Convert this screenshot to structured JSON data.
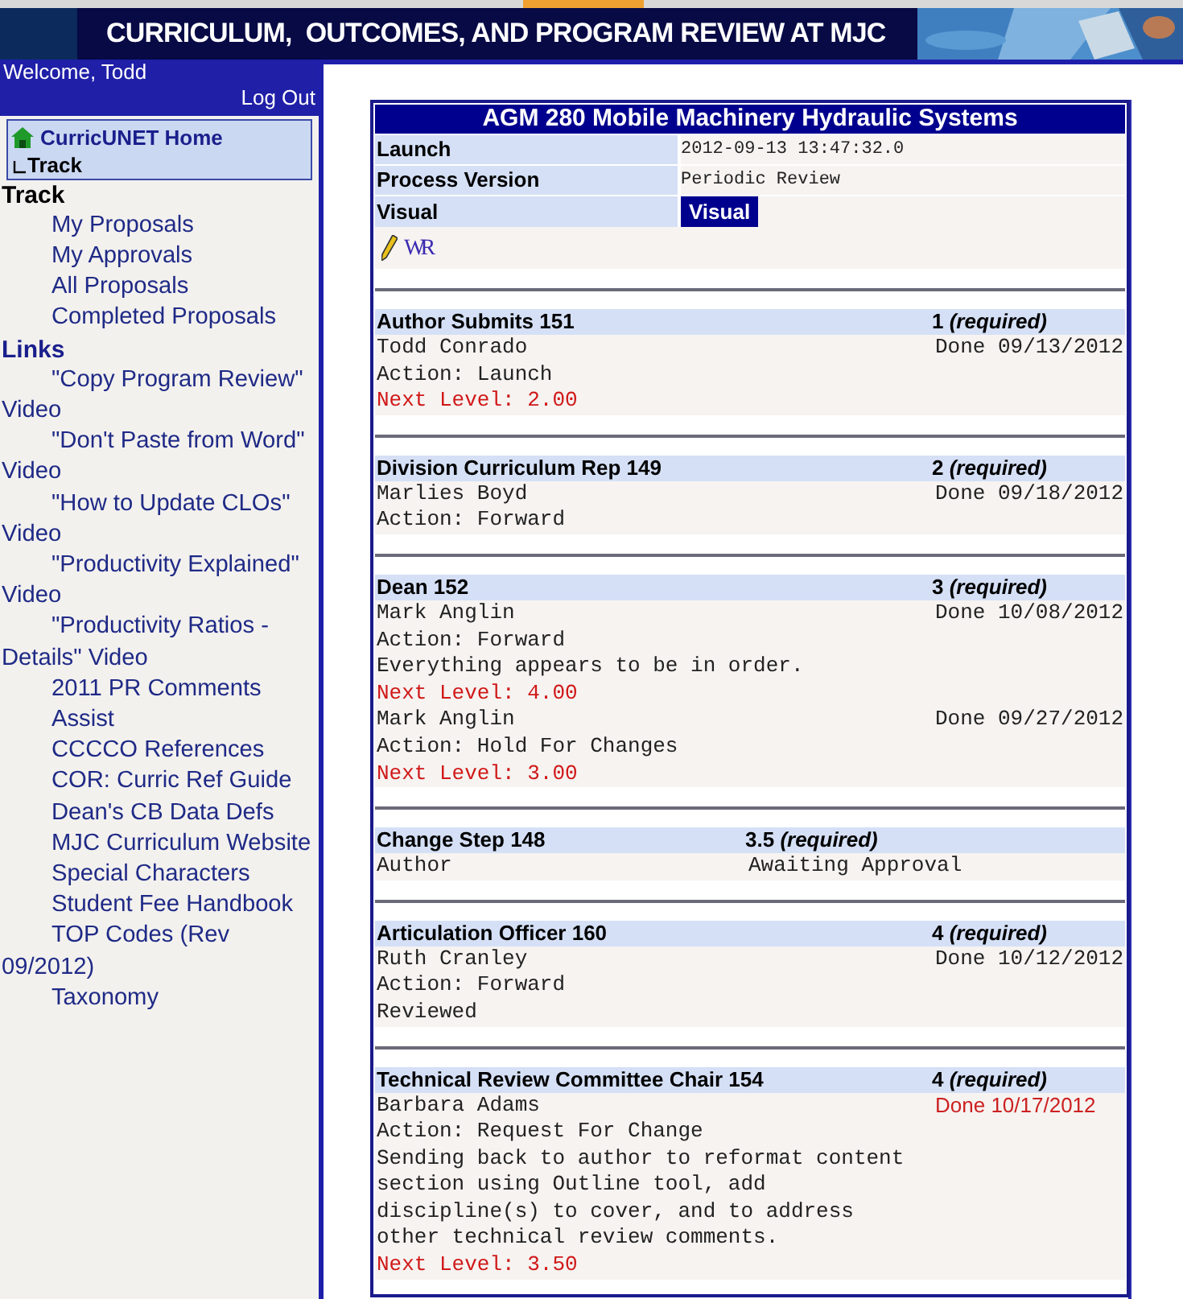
{
  "banner": {
    "title": "CURRICULUM,  OUTCOMES, AND PROGRAM REVIEW AT MJC"
  },
  "sidebar": {
    "welcome": "Welcome, Todd",
    "logout": "Log Out",
    "breadcrumb": {
      "home": "CurricUNET Home",
      "current": "Track"
    },
    "sections": [
      {
        "heading": "Track",
        "kind": "plain",
        "items": [
          "My Proposals",
          "My Approvals",
          "All Proposals",
          "Completed Proposals"
        ]
      },
      {
        "heading": "Links",
        "kind": "link",
        "items": [
          "\"Copy Program Review\" Video",
          "\"Don't Paste from Word\" Video",
          "\"How to Update CLOs\" Video",
          "\"Productivity Explained\" Video",
          "\"Productivity Ratios - Details\" Video",
          "2011 PR Comments",
          "Assist",
          "CCCCO References",
          "COR: Curric Ref Guide",
          "Dean's CB Data Defs",
          "MJC Curriculum Website",
          "Special Characters",
          "Student Fee Handbook",
          "TOP Codes (Rev 09/2012)",
          "Taxonomy"
        ]
      }
    ]
  },
  "proposal": {
    "title": "AGM 280 Mobile Machinery Hydraulic Systems",
    "fields": [
      {
        "label": "Launch",
        "value": "2012-09-13 13:47:32.0",
        "kind": "text"
      },
      {
        "label": "Process Version",
        "value": "Periodic Review",
        "kind": "text"
      },
      {
        "label": "Visual",
        "value": "Visual",
        "kind": "button"
      }
    ],
    "logo_text": "WR"
  },
  "steps": [
    {
      "title": "Author Submits 151",
      "level": "1 *(required)*",
      "kind": "standard",
      "entries": [
        {
          "person": "Todd Conrado",
          "action": "Action: Launch",
          "next_level": "Next Level: 2.00",
          "status": "Done 09/13/2012",
          "flagged": false
        }
      ]
    },
    {
      "title": "Division Curriculum Rep 149",
      "level": "2 *(required)*",
      "kind": "standard",
      "entries": [
        {
          "person": "Marlies Boyd",
          "action": "Action: Forward",
          "status": "Done 09/18/2012",
          "flagged": false
        }
      ]
    },
    {
      "title": "Dean 152",
      "level": "3 *(required)*",
      "kind": "standard",
      "entries": [
        {
          "person": "Mark Anglin",
          "action": "Action: Forward",
          "comment": "Everything appears to be in order.",
          "next_level": "Next Level: 4.00",
          "status": "Done 10/08/2012",
          "flagged": false
        },
        {
          "person": "Mark Anglin",
          "action": "Action: Hold For Changes",
          "next_level": "Next Level: 3.00",
          "status": "Done 09/27/2012",
          "flagged": false
        }
      ]
    },
    {
      "title": "Change Step 148",
      "level": "3.5 *(required)*",
      "kind": "split",
      "entries": [
        {
          "person": "Author",
          "status": "Awaiting Approval",
          "flagged": false
        }
      ]
    },
    {
      "title": "Articulation Officer 160",
      "level": "4 *(required)*",
      "kind": "standard",
      "entries": [
        {
          "person": "Ruth Cranley",
          "action": "Action: Forward",
          "comment": "Reviewed",
          "status": "Done 10/12/2012",
          "flagged": false
        }
      ]
    },
    {
      "title": "Technical Review Committee Chair 154",
      "level": "4 *(required)*",
      "kind": "standard",
      "entries": [
        {
          "person": "Barbara Adams",
          "action": "Action: Request For Change",
          "comment": "Sending back to author to reformat content section using Outline tool, add discipline(s) to cover, and to address other technical review comments.",
          "next_level": "Next Level: 3.50",
          "status": "Done 10/17/2012",
          "flagged": true
        }
      ]
    }
  ]
}
